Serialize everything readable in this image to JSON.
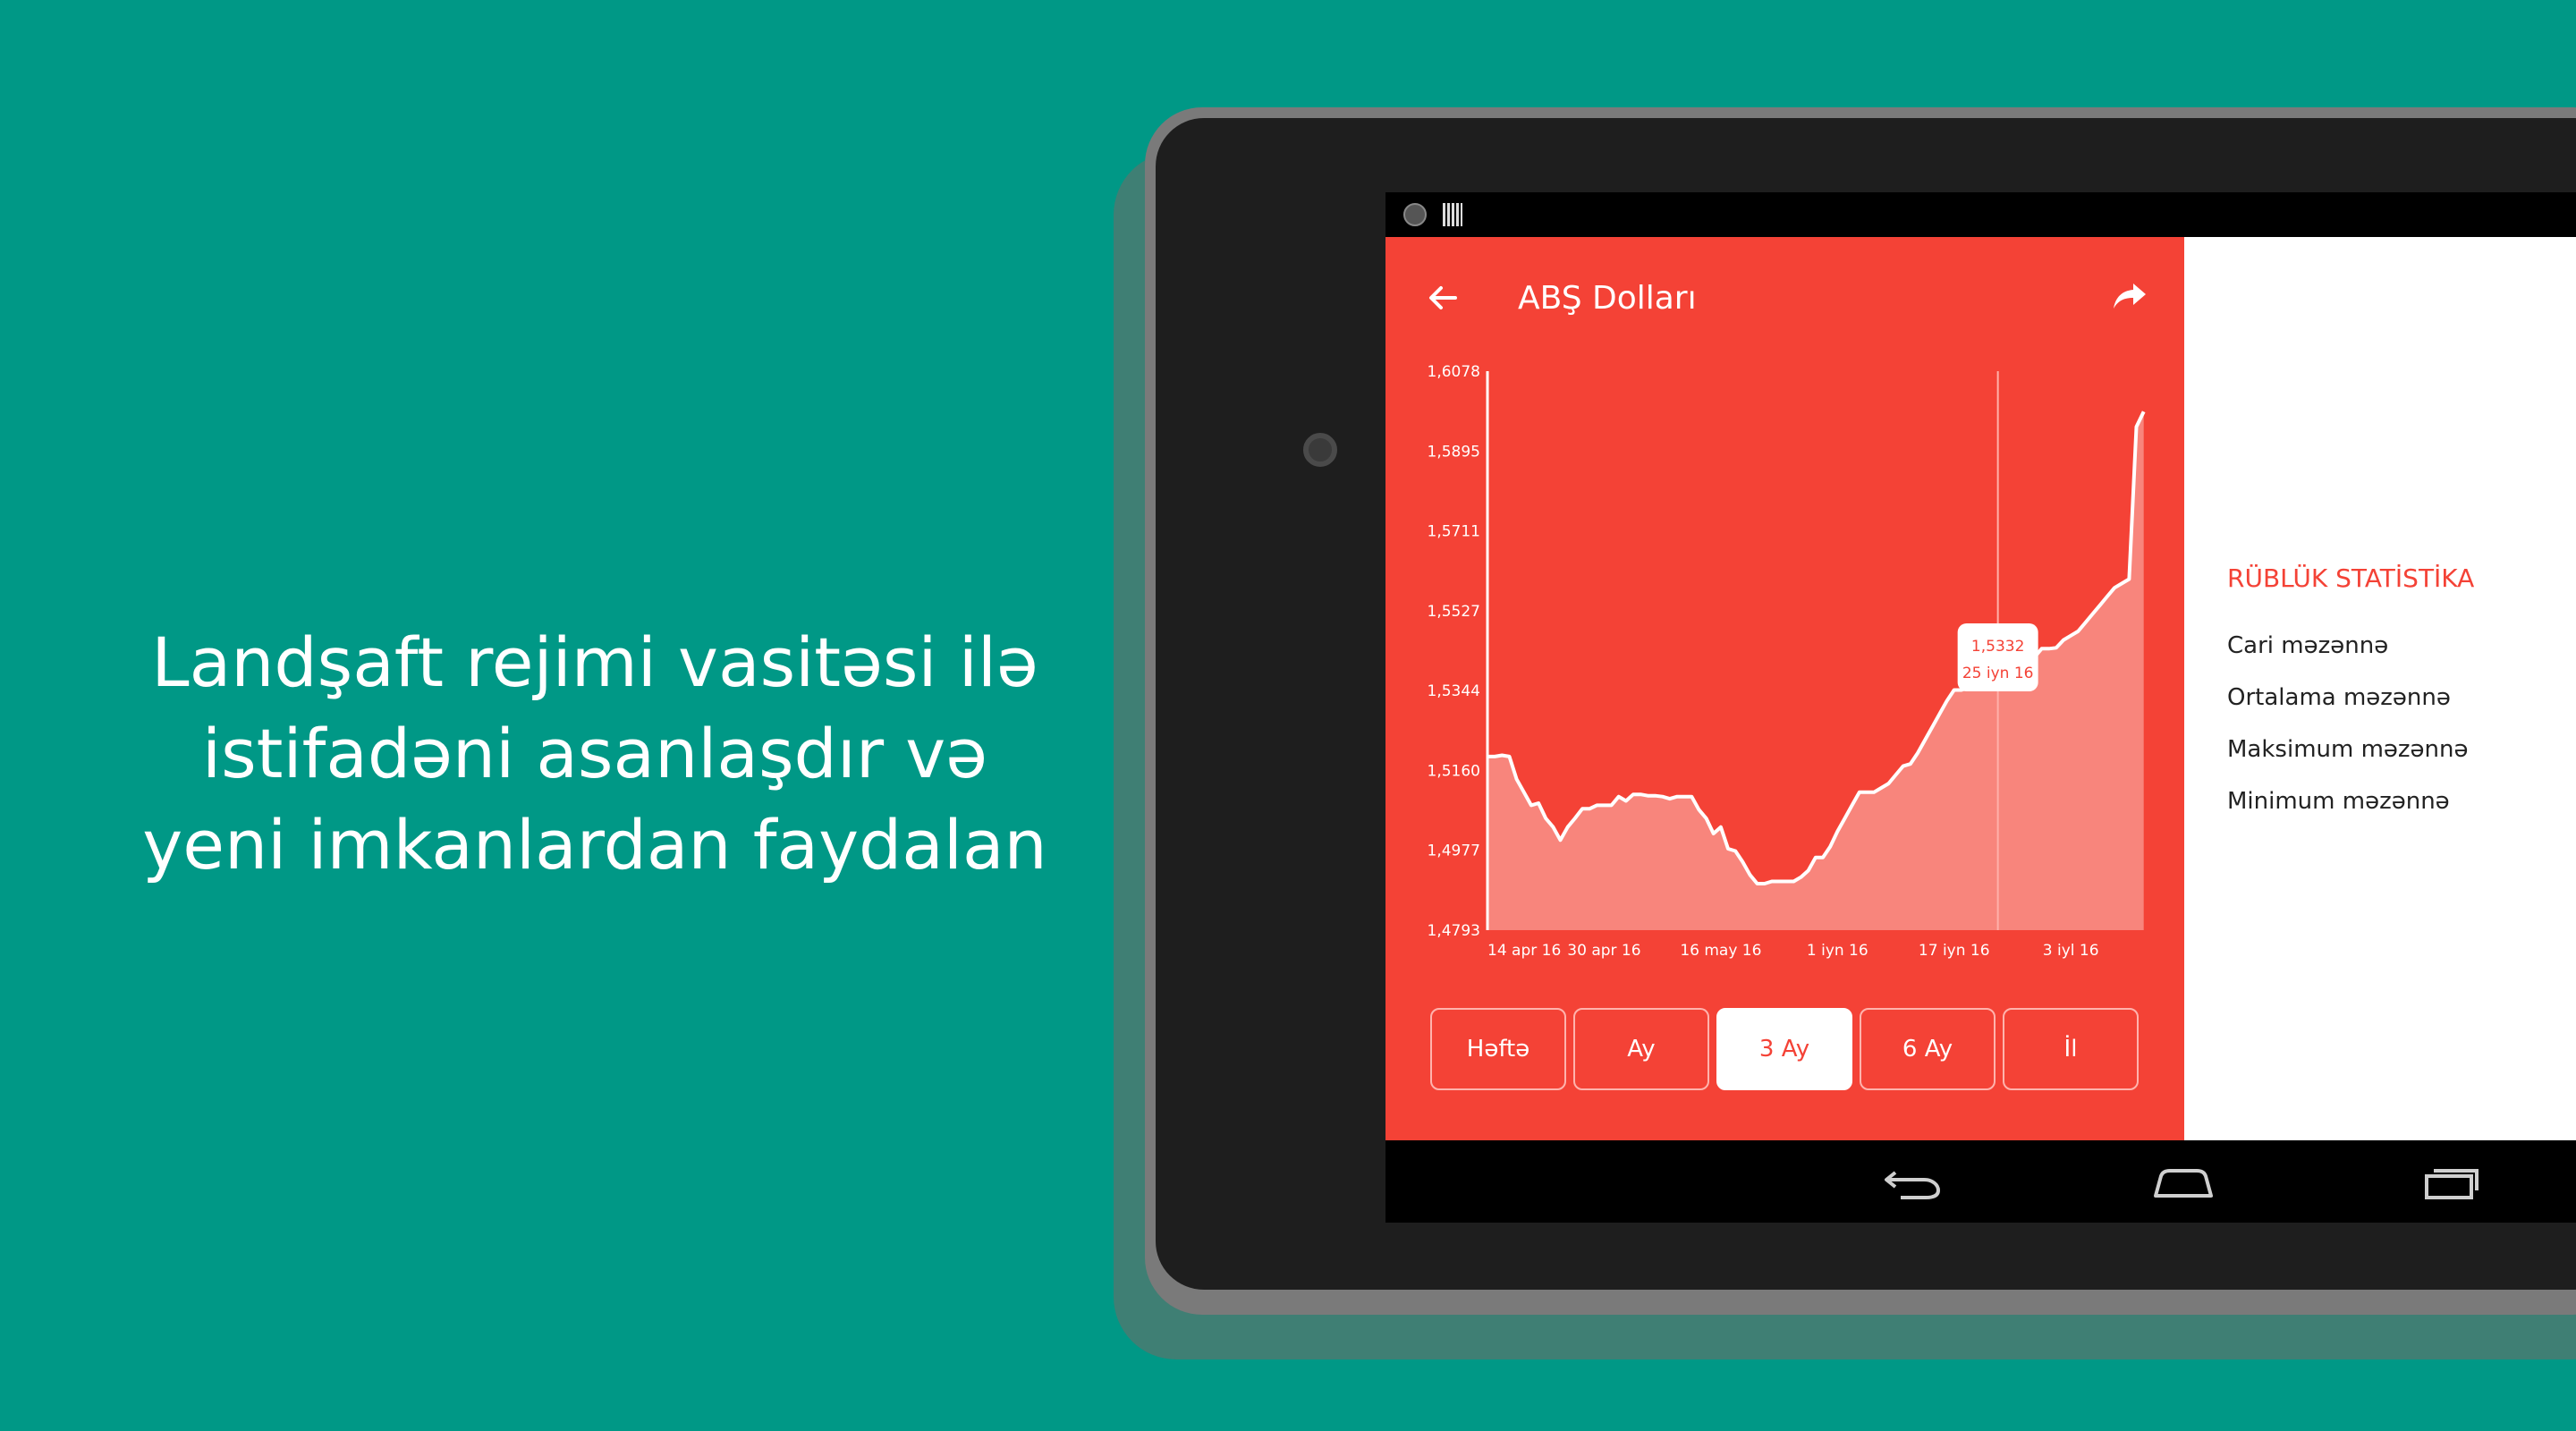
{
  "promo": {
    "lines": [
      "Landşaft rejimi vasitəsi ilə",
      "istifadəni asanlaşdır və",
      "yeni imkanlardan faydalan"
    ]
  },
  "app": {
    "title": "ABŞ Dolları",
    "back_icon": "arrow-left-icon",
    "share_icon": "share-icon"
  },
  "range_buttons": [
    {
      "label": "Həftə",
      "active": false
    },
    {
      "label": "Ay",
      "active": false
    },
    {
      "label": "3 Ay",
      "active": true
    },
    {
      "label": "6 Ay",
      "active": false
    },
    {
      "label": "İl",
      "active": false
    }
  ],
  "stats": {
    "title": "RÜBLÜK STATİSTİKA",
    "rows": [
      "Cari məzənnə",
      "Ortalama məzənnə",
      "Maksimum məzənnə",
      "Minimum məzənnə"
    ]
  },
  "colors": {
    "background": "#009886",
    "accent": "#f44236",
    "area_fill": "#f8857c",
    "line": "#ffffff"
  },
  "chart_data": {
    "type": "area",
    "title": "",
    "xlabel": "",
    "ylabel": "",
    "y_ticks": [
      "1,6078",
      "1,5895",
      "1,5711",
      "1,5527",
      "1,5344",
      "1,5160",
      "1,4977",
      "1,4793"
    ],
    "x_ticks": [
      "14 apr 16",
      "30 apr 16",
      "16 may 16",
      "1 iyn 16",
      "17 iyn 16",
      "3 iyl 16"
    ],
    "ylim": [
      1.4793,
      1.6078
    ],
    "x_range_days": [
      0,
      92
    ],
    "x_tick_days": [
      0,
      16,
      32,
      48,
      64,
      80
    ],
    "points": [
      [
        0,
        1.5192
      ],
      [
        1,
        1.5192
      ],
      [
        2,
        1.5195
      ],
      [
        3,
        1.5192
      ],
      [
        4,
        1.514
      ],
      [
        5,
        1.511
      ],
      [
        6,
        1.508
      ],
      [
        7,
        1.5085
      ],
      [
        8,
        1.505
      ],
      [
        9,
        1.503
      ],
      [
        10,
        1.5
      ],
      [
        11,
        1.503
      ],
      [
        12,
        1.505
      ],
      [
        13,
        1.5072
      ],
      [
        14,
        1.5072
      ],
      [
        15,
        1.508
      ],
      [
        16,
        1.508
      ],
      [
        17,
        1.508
      ],
      [
        18,
        1.51
      ],
      [
        19,
        1.509
      ],
      [
        20,
        1.5105
      ],
      [
        21,
        1.5105
      ],
      [
        22,
        1.5102
      ],
      [
        23,
        1.5102
      ],
      [
        24,
        1.51
      ],
      [
        25,
        1.5095
      ],
      [
        26,
        1.51
      ],
      [
        27,
        1.51
      ],
      [
        28,
        1.51
      ],
      [
        29,
        1.507
      ],
      [
        30,
        1.505
      ],
      [
        31,
        1.5015
      ],
      [
        32,
        1.503
      ],
      [
        33,
        1.498
      ],
      [
        34,
        1.4975
      ],
      [
        35,
        1.495
      ],
      [
        36,
        1.492
      ],
      [
        37,
        1.49
      ],
      [
        38,
        1.49
      ],
      [
        39,
        1.4905
      ],
      [
        40,
        1.4905
      ],
      [
        41,
        1.4905
      ],
      [
        42,
        1.4905
      ],
      [
        43,
        1.4915
      ],
      [
        44,
        1.493
      ],
      [
        45,
        1.496
      ],
      [
        46,
        1.496
      ],
      [
        47,
        1.4985
      ],
      [
        48,
        1.502
      ],
      [
        49,
        1.505
      ],
      [
        50,
        1.508
      ],
      [
        51,
        1.511
      ],
      [
        52,
        1.511
      ],
      [
        53,
        1.511
      ],
      [
        54,
        1.512
      ],
      [
        55,
        1.513
      ],
      [
        56,
        1.515
      ],
      [
        57,
        1.517
      ],
      [
        58,
        1.5175
      ],
      [
        59,
        1.52
      ],
      [
        60,
        1.523
      ],
      [
        61,
        1.526
      ],
      [
        62,
        1.529
      ],
      [
        63,
        1.532
      ],
      [
        64,
        1.5345
      ],
      [
        65,
        1.5345
      ],
      [
        66,
        1.535
      ],
      [
        67,
        1.5395
      ],
      [
        68,
        1.54
      ],
      [
        69,
        1.54
      ],
      [
        70,
        1.54
      ],
      [
        71,
        1.54
      ],
      [
        72,
        1.54
      ],
      [
        73,
        1.54
      ],
      [
        74,
        1.542
      ],
      [
        75,
        1.542
      ],
      [
        76,
        1.544
      ],
      [
        77,
        1.544
      ],
      [
        78,
        1.5442
      ],
      [
        79,
        1.546
      ],
      [
        80,
        1.547
      ],
      [
        81,
        1.548
      ],
      [
        82,
        1.55
      ],
      [
        83,
        1.552
      ],
      [
        84,
        1.554
      ],
      [
        85,
        1.556
      ],
      [
        86,
        1.558
      ],
      [
        87,
        1.559
      ],
      [
        88,
        1.56
      ],
      [
        89,
        1.595
      ],
      [
        90,
        1.5985
      ]
    ],
    "tooltip": {
      "day": 70,
      "value": "1,5332",
      "date": "25 iyn 16"
    }
  }
}
